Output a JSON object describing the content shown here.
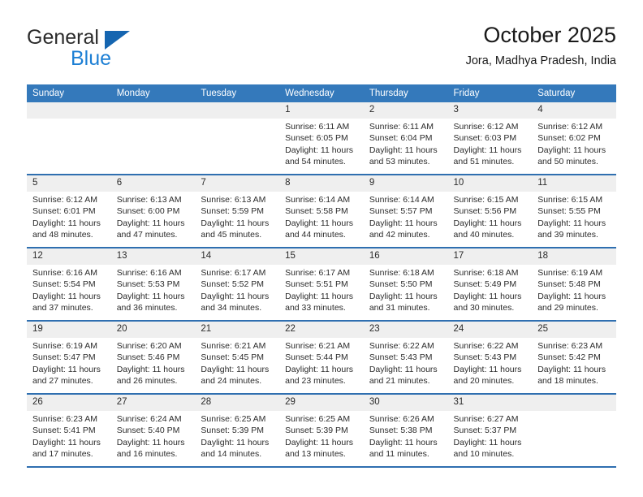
{
  "brand": {
    "word1": "General",
    "word2": "Blue",
    "logo_icon": "triangle-logo-icon",
    "color_blue": "#1d7fd4",
    "color_triangle": "#1565b0"
  },
  "header": {
    "title": "October 2025",
    "location": "Jora, Madhya Pradesh, India"
  },
  "theme": {
    "header_bg": "#3479bb",
    "row_divider": "#2f6fb0",
    "daynum_bg": "#efefef"
  },
  "calendar": {
    "weekdays": [
      "Sunday",
      "Monday",
      "Tuesday",
      "Wednesday",
      "Thursday",
      "Friday",
      "Saturday"
    ],
    "weeks": [
      [
        {
          "day": "",
          "blank": true,
          "sunrise": "",
          "sunset": "",
          "daylight1": "",
          "daylight2": ""
        },
        {
          "day": "",
          "blank": true,
          "sunrise": "",
          "sunset": "",
          "daylight1": "",
          "daylight2": ""
        },
        {
          "day": "",
          "blank": true,
          "sunrise": "",
          "sunset": "",
          "daylight1": "",
          "daylight2": ""
        },
        {
          "day": "1",
          "sunrise": "Sunrise: 6:11 AM",
          "sunset": "Sunset: 6:05 PM",
          "daylight1": "Daylight: 11 hours",
          "daylight2": "and 54 minutes."
        },
        {
          "day": "2",
          "sunrise": "Sunrise: 6:11 AM",
          "sunset": "Sunset: 6:04 PM",
          "daylight1": "Daylight: 11 hours",
          "daylight2": "and 53 minutes."
        },
        {
          "day": "3",
          "sunrise": "Sunrise: 6:12 AM",
          "sunset": "Sunset: 6:03 PM",
          "daylight1": "Daylight: 11 hours",
          "daylight2": "and 51 minutes."
        },
        {
          "day": "4",
          "sunrise": "Sunrise: 6:12 AM",
          "sunset": "Sunset: 6:02 PM",
          "daylight1": "Daylight: 11 hours",
          "daylight2": "and 50 minutes."
        }
      ],
      [
        {
          "day": "5",
          "sunrise": "Sunrise: 6:12 AM",
          "sunset": "Sunset: 6:01 PM",
          "daylight1": "Daylight: 11 hours",
          "daylight2": "and 48 minutes."
        },
        {
          "day": "6",
          "sunrise": "Sunrise: 6:13 AM",
          "sunset": "Sunset: 6:00 PM",
          "daylight1": "Daylight: 11 hours",
          "daylight2": "and 47 minutes."
        },
        {
          "day": "7",
          "sunrise": "Sunrise: 6:13 AM",
          "sunset": "Sunset: 5:59 PM",
          "daylight1": "Daylight: 11 hours",
          "daylight2": "and 45 minutes."
        },
        {
          "day": "8",
          "sunrise": "Sunrise: 6:14 AM",
          "sunset": "Sunset: 5:58 PM",
          "daylight1": "Daylight: 11 hours",
          "daylight2": "and 44 minutes."
        },
        {
          "day": "9",
          "sunrise": "Sunrise: 6:14 AM",
          "sunset": "Sunset: 5:57 PM",
          "daylight1": "Daylight: 11 hours",
          "daylight2": "and 42 minutes."
        },
        {
          "day": "10",
          "sunrise": "Sunrise: 6:15 AM",
          "sunset": "Sunset: 5:56 PM",
          "daylight1": "Daylight: 11 hours",
          "daylight2": "and 40 minutes."
        },
        {
          "day": "11",
          "sunrise": "Sunrise: 6:15 AM",
          "sunset": "Sunset: 5:55 PM",
          "daylight1": "Daylight: 11 hours",
          "daylight2": "and 39 minutes."
        }
      ],
      [
        {
          "day": "12",
          "sunrise": "Sunrise: 6:16 AM",
          "sunset": "Sunset: 5:54 PM",
          "daylight1": "Daylight: 11 hours",
          "daylight2": "and 37 minutes."
        },
        {
          "day": "13",
          "sunrise": "Sunrise: 6:16 AM",
          "sunset": "Sunset: 5:53 PM",
          "daylight1": "Daylight: 11 hours",
          "daylight2": "and 36 minutes."
        },
        {
          "day": "14",
          "sunrise": "Sunrise: 6:17 AM",
          "sunset": "Sunset: 5:52 PM",
          "daylight1": "Daylight: 11 hours",
          "daylight2": "and 34 minutes."
        },
        {
          "day": "15",
          "sunrise": "Sunrise: 6:17 AM",
          "sunset": "Sunset: 5:51 PM",
          "daylight1": "Daylight: 11 hours",
          "daylight2": "and 33 minutes."
        },
        {
          "day": "16",
          "sunrise": "Sunrise: 6:18 AM",
          "sunset": "Sunset: 5:50 PM",
          "daylight1": "Daylight: 11 hours",
          "daylight2": "and 31 minutes."
        },
        {
          "day": "17",
          "sunrise": "Sunrise: 6:18 AM",
          "sunset": "Sunset: 5:49 PM",
          "daylight1": "Daylight: 11 hours",
          "daylight2": "and 30 minutes."
        },
        {
          "day": "18",
          "sunrise": "Sunrise: 6:19 AM",
          "sunset": "Sunset: 5:48 PM",
          "daylight1": "Daylight: 11 hours",
          "daylight2": "and 29 minutes."
        }
      ],
      [
        {
          "day": "19",
          "sunrise": "Sunrise: 6:19 AM",
          "sunset": "Sunset: 5:47 PM",
          "daylight1": "Daylight: 11 hours",
          "daylight2": "and 27 minutes."
        },
        {
          "day": "20",
          "sunrise": "Sunrise: 6:20 AM",
          "sunset": "Sunset: 5:46 PM",
          "daylight1": "Daylight: 11 hours",
          "daylight2": "and 26 minutes."
        },
        {
          "day": "21",
          "sunrise": "Sunrise: 6:21 AM",
          "sunset": "Sunset: 5:45 PM",
          "daylight1": "Daylight: 11 hours",
          "daylight2": "and 24 minutes."
        },
        {
          "day": "22",
          "sunrise": "Sunrise: 6:21 AM",
          "sunset": "Sunset: 5:44 PM",
          "daylight1": "Daylight: 11 hours",
          "daylight2": "and 23 minutes."
        },
        {
          "day": "23",
          "sunrise": "Sunrise: 6:22 AM",
          "sunset": "Sunset: 5:43 PM",
          "daylight1": "Daylight: 11 hours",
          "daylight2": "and 21 minutes."
        },
        {
          "day": "24",
          "sunrise": "Sunrise: 6:22 AM",
          "sunset": "Sunset: 5:43 PM",
          "daylight1": "Daylight: 11 hours",
          "daylight2": "and 20 minutes."
        },
        {
          "day": "25",
          "sunrise": "Sunrise: 6:23 AM",
          "sunset": "Sunset: 5:42 PM",
          "daylight1": "Daylight: 11 hours",
          "daylight2": "and 18 minutes."
        }
      ],
      [
        {
          "day": "26",
          "sunrise": "Sunrise: 6:23 AM",
          "sunset": "Sunset: 5:41 PM",
          "daylight1": "Daylight: 11 hours",
          "daylight2": "and 17 minutes."
        },
        {
          "day": "27",
          "sunrise": "Sunrise: 6:24 AM",
          "sunset": "Sunset: 5:40 PM",
          "daylight1": "Daylight: 11 hours",
          "daylight2": "and 16 minutes."
        },
        {
          "day": "28",
          "sunrise": "Sunrise: 6:25 AM",
          "sunset": "Sunset: 5:39 PM",
          "daylight1": "Daylight: 11 hours",
          "daylight2": "and 14 minutes."
        },
        {
          "day": "29",
          "sunrise": "Sunrise: 6:25 AM",
          "sunset": "Sunset: 5:39 PM",
          "daylight1": "Daylight: 11 hours",
          "daylight2": "and 13 minutes."
        },
        {
          "day": "30",
          "sunrise": "Sunrise: 6:26 AM",
          "sunset": "Sunset: 5:38 PM",
          "daylight1": "Daylight: 11 hours",
          "daylight2": "and 11 minutes."
        },
        {
          "day": "31",
          "sunrise": "Sunrise: 6:27 AM",
          "sunset": "Sunset: 5:37 PM",
          "daylight1": "Daylight: 11 hours",
          "daylight2": "and 10 minutes."
        },
        {
          "day": "",
          "blank": true,
          "sunrise": "",
          "sunset": "",
          "daylight1": "",
          "daylight2": ""
        }
      ]
    ]
  }
}
